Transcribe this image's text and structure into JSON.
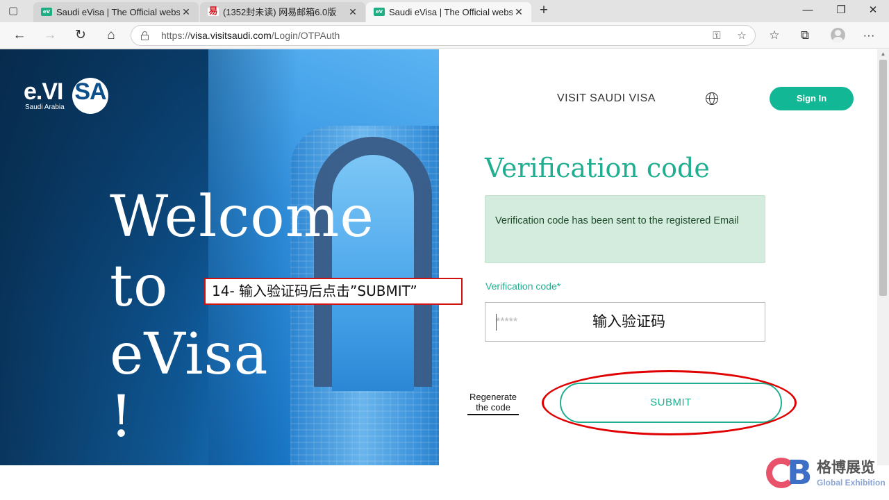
{
  "browser": {
    "tabs": [
      {
        "title": "Saudi eVisa | The Official website",
        "favicon": "evisa-favicon",
        "active": false
      },
      {
        "title": "(1352封未读) 网易邮箱6.0版",
        "favicon": "netease-mail-favicon",
        "active": false
      },
      {
        "title": "Saudi eVisa | The Official website",
        "favicon": "evisa-favicon",
        "active": true
      }
    ],
    "tab_close_glyph": "✕",
    "new_tab_glyph": "+",
    "favicon_evisa_text": "eV",
    "favicon_mail_text": "易",
    "window_controls": {
      "minimize": "—",
      "restore": "❐",
      "close": "✕"
    },
    "nav": {
      "back": "←",
      "forward": "→",
      "refresh": "↻",
      "home": "⌂"
    },
    "url": {
      "scheme": "https://",
      "host": "visa.visitsaudi.com",
      "path": "/Login/OTPAuth"
    },
    "url_icons": {
      "key": "⚿",
      "favorite_add": "☆"
    },
    "toolbar_icons": {
      "favorites": "☆",
      "collections": "⧉",
      "menu": "···"
    },
    "icons": [
      "tab-actions-icon",
      "lock-icon",
      "key-icon",
      "favorite-add-icon",
      "favorites-icon",
      "collections-icon",
      "avatar",
      "more-icon"
    ]
  },
  "hero": {
    "logo": {
      "word": "e.VI",
      "circle": "SA",
      "subtitle": "Saudi Arabia"
    },
    "welcome_lines": [
      "Welcome",
      "to",
      "eVisa",
      "!"
    ]
  },
  "header": {
    "nav_link": "VISIT SAUDI VISA",
    "language_icon": "globe-icon",
    "sign_in_label": "Sign In"
  },
  "form": {
    "title": "Verification code",
    "alert_message": "Verification code has been sent to the registered Email",
    "field_label": "Verification code*",
    "field_placeholder": "*****",
    "field_value": "",
    "regenerate_label": "Regenerate the code",
    "submit_label": "SUBMIT"
  },
  "annotations": {
    "callout": "14- 输入验证码后点击”SUBMIT”",
    "input_hint": "输入验证码"
  },
  "scrollbar": {
    "up_glyph": "▲"
  },
  "watermark": {
    "chinese": "格博展览",
    "english": "Global Exhibition",
    "mark": "B"
  },
  "colors": {
    "brand_green": "#1fae8f",
    "sign_in_bg": "#12b896",
    "alert_bg": "#d4ecde",
    "alert_text": "#1f4d2c",
    "annotation_red": "#e00000"
  }
}
